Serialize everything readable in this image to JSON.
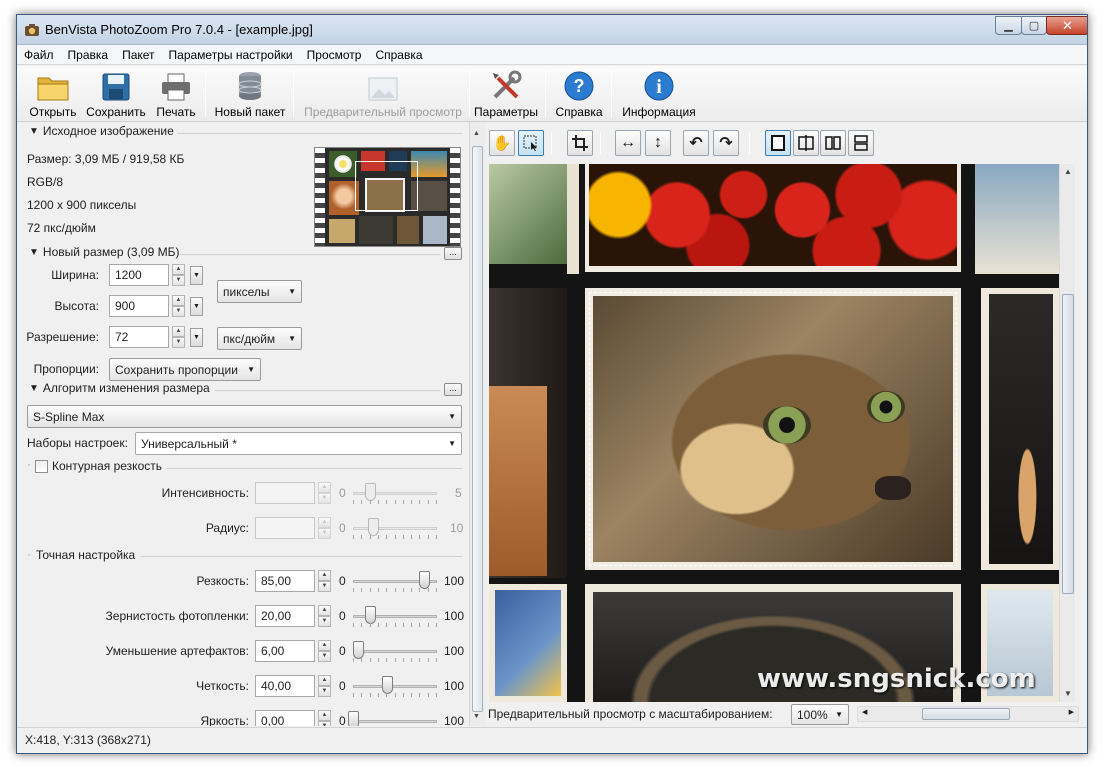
{
  "window": {
    "title": "BenVista PhotoZoom Pro 7.0.4 - [example.jpg]"
  },
  "menu": [
    "Файл",
    "Правка",
    "Пакет",
    "Параметры настройки",
    "Просмотр",
    "Справка"
  ],
  "toolbar": {
    "open": "Открыть",
    "save": "Сохранить",
    "print": "Печать",
    "batch": "Новый пакет",
    "preview": "Предварительный просмотр",
    "settings": "Параметры",
    "help": "Справка",
    "info": "Информация"
  },
  "source": {
    "header": "Исходное изображение",
    "size": "Размер: 3,09 МБ / 919,58 КБ",
    "mode": "RGB/8",
    "pixels": "1200 x 900 пикселы",
    "dpi": "72 пкс/дюйм"
  },
  "resize": {
    "header": "Новый размер (3,09 МБ)",
    "more": "...",
    "width_label": "Ширина:",
    "width": "1200",
    "height_label": "Высота:",
    "height": "900",
    "units": "пикселы",
    "res_label": "Разрешение:",
    "res": "72",
    "res_units": "пкс/дюйм",
    "prop_label": "Пропорции:",
    "prop": "Сохранить пропорции"
  },
  "algo": {
    "header": "Алгоритм изменения размера",
    "more": "...",
    "method": "S-Spline Max",
    "preset_label": "Наборы настроек:",
    "preset": "Универсальный *"
  },
  "contour": {
    "label": "Контурная резкость",
    "checked": false,
    "intensity_label": "Интенсивность:",
    "intensity_min": "0",
    "intensity_max": "5",
    "intensity_value": 0.2,
    "radius_label": "Радиус:",
    "radius_min": "0",
    "radius_max": "10",
    "radius_value": 0.24
  },
  "fine": {
    "header": "Точная настройка",
    "rows": [
      {
        "label": "Резкость:",
        "value": "85,00",
        "min": "0",
        "max": "100",
        "level": 0.85
      },
      {
        "label": "Зернистость фотопленки:",
        "value": "20,00",
        "min": "0",
        "max": "100",
        "level": 0.2
      },
      {
        "label": "Уменьшение артефактов:",
        "value": "6,00",
        "min": "0",
        "max": "100",
        "level": 0.06
      },
      {
        "label": "Четкость:",
        "value": "40,00",
        "min": "0",
        "max": "100",
        "level": 0.4
      },
      {
        "label": "Яркость:",
        "value": "0,00",
        "min": "0",
        "max": "100",
        "level": 0.0
      }
    ]
  },
  "preview_bar": {
    "label": "Предварительный просмотр с масштабированием:",
    "zoom": "100%"
  },
  "watermark": "www.sngsnick.com",
  "status": "X:418, Y:313  (368x271)",
  "colors": {
    "accent": "#3c7fb1",
    "close": "#c4442a"
  }
}
